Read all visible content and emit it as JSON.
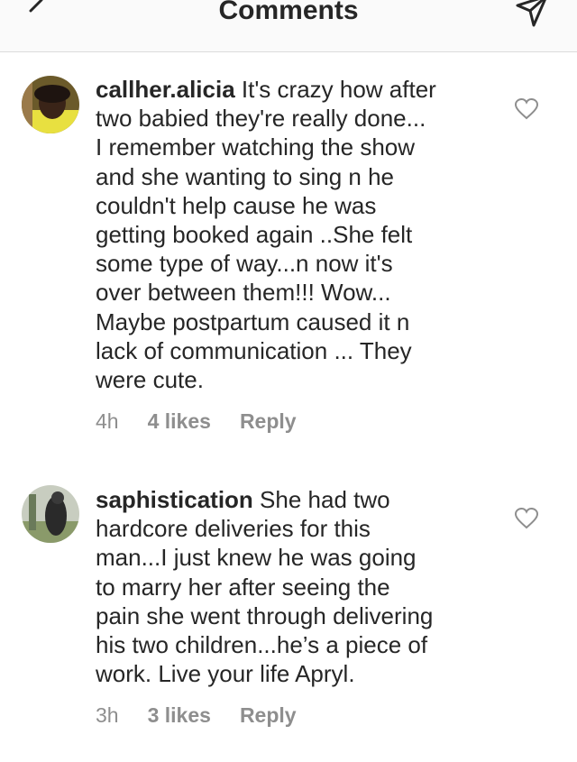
{
  "header": {
    "title": "Comments",
    "back_icon": "chevron-left-icon",
    "send_icon": "paper-plane-icon"
  },
  "comments": [
    {
      "username": "callher.alicia",
      "text": " It's crazy how after\ntwo babied they're really done...\nI remember watching the show\nand she wanting to sing n he\ncouldn't help cause he was\ngetting booked again ..She felt\nsome type of way...n now it's\nover between them!!! Wow...\nMaybe postpartum caused it n\nlack of communication ... They\nwere cute.",
      "time": "4h",
      "likes": "4 likes",
      "reply": "Reply"
    },
    {
      "username": "saphistication",
      "text": " She had two\nhardcore deliveries for this\nman...I just knew he was going\nto marry her after seeing the\npain she went through delivering\nhis two children...he’s a piece of\nwork. Live your life Apryl.",
      "time": "3h",
      "likes": "3 likes",
      "reply": "Reply"
    }
  ],
  "colors": {
    "text": "#262626",
    "muted": "#8e8e8e",
    "header_bg": "#fafafa",
    "divider": "#dbdbdb"
  }
}
